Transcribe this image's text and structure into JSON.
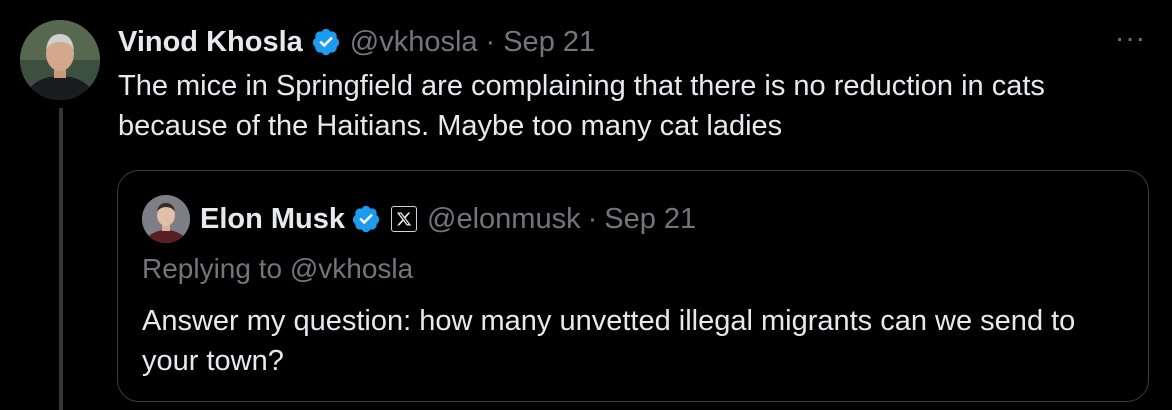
{
  "tweet": {
    "author_name": "Vinod Khosla",
    "handle": "@vkhosla",
    "separator": "·",
    "date": "Sep 21",
    "text": "The mice in Springfield are complaining that there is no reduction in cats because of the Haitians. Maybe too many cat ladies",
    "more_icon": "more-horizontal-icon",
    "more_glyph": "···",
    "verified": true
  },
  "quoted_tweet": {
    "author_name": "Elon Musk",
    "handle": "@elonmusk",
    "separator": "·",
    "date": "Sep 21",
    "replying_to": "Replying to @vkhosla",
    "text": "Answer my question: how many unvetted illegal migrants can we send to your town?",
    "verified": true,
    "affiliation_badge": "x-logo-icon"
  },
  "colors": {
    "background": "#000000",
    "text_primary": "#e7e9ea",
    "text_secondary": "#71767b",
    "verified_blue": "#1d9bf0",
    "border": "#3a3d41",
    "thread_line": "#333639"
  }
}
